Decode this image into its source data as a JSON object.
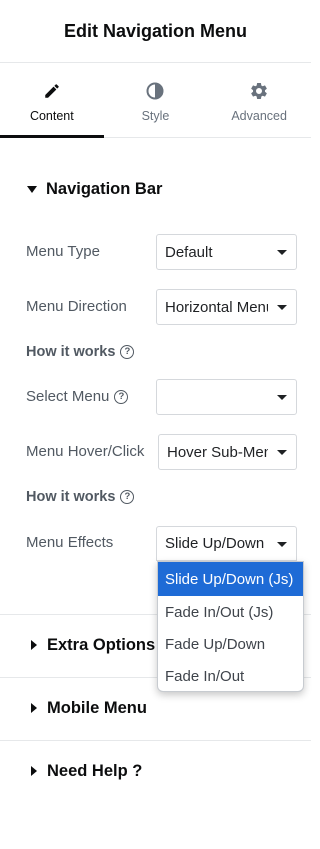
{
  "header": {
    "title": "Edit Navigation Menu"
  },
  "tabs": [
    {
      "label": "Content",
      "icon": "pencil-icon",
      "active": true
    },
    {
      "label": "Style",
      "icon": "contrast-icon",
      "active": false
    },
    {
      "label": "Advanced",
      "icon": "gear-icon",
      "active": false
    }
  ],
  "nav_section": {
    "title": "Navigation Bar",
    "menu_type": {
      "label": "Menu Type",
      "value": "Default"
    },
    "menu_direction": {
      "label": "Menu Direction",
      "value": "Horizontal Menu"
    },
    "how_it_works_1": "How it works",
    "select_menu": {
      "label": "Select Menu",
      "value": ""
    },
    "menu_hover": {
      "label": "Menu Hover/Click",
      "value": "Hover Sub-Menu"
    },
    "how_it_works_2": "How it works",
    "menu_effects": {
      "label": "Menu Effects",
      "value": "Slide Up/Down"
    }
  },
  "effects_dropdown": {
    "options": [
      "Slide Up/Down (Js)",
      "Fade In/Out (Js)",
      "Fade Up/Down",
      "Fade In/Out"
    ],
    "selected": "Slide Up/Down (Js)",
    "highlight_color": "#1e6bd6"
  },
  "collapsed_sections": [
    {
      "title": "Extra Options"
    },
    {
      "title": "Mobile Menu"
    },
    {
      "title": "Need Help ?"
    }
  ],
  "help_glyph": "?"
}
